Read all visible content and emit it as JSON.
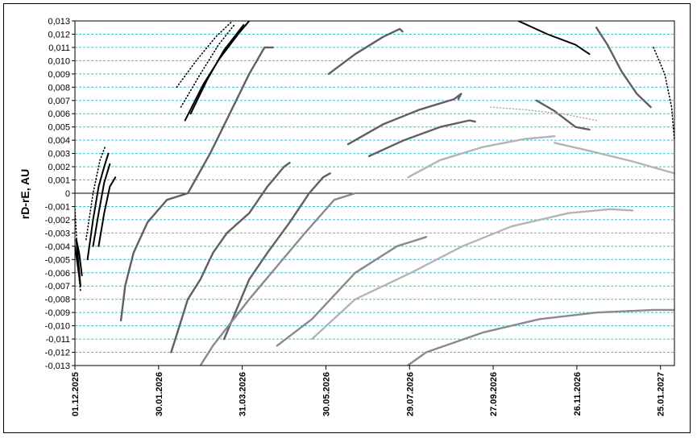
{
  "chart_data": {
    "type": "scatter",
    "ylabel": "rD-rE, AU",
    "xlabel": "",
    "ylim": [
      -0.013,
      0.013
    ],
    "ytick_step": 0.001,
    "xlim": [
      "2025-12-01",
      "2027-02-04"
    ],
    "x_ticks": [
      "01.12.2025",
      "30.01.2026",
      "31.03.2026",
      "30.05.2026",
      "29.07.2026",
      "27.09.2026",
      "26.11.2026",
      "25.01.2027"
    ],
    "grid": {
      "horizontal": true,
      "style": "dashed",
      "color": "#33c3d3"
    },
    "zero_line": true,
    "colors": {
      "black": "#000000",
      "dark": "#606060",
      "mid": "#8a8a8a",
      "light": "#b4b4b4",
      "grid": "#33c3d3"
    },
    "series": [
      {
        "color": "black",
        "style": "solid",
        "points": [
          [
            "2025-12-01",
            -0.004
          ],
          [
            "2025-12-03",
            -0.0055
          ],
          [
            "2025-12-05",
            -0.007
          ],
          [
            "2025-12-02",
            -0.0035
          ],
          [
            "2025-12-04",
            -0.0045
          ],
          [
            "2025-12-06",
            -0.0062
          ]
        ]
      },
      {
        "color": "black",
        "style": "dots",
        "points": [
          [
            "2025-12-01",
            -0.0012
          ],
          [
            "2025-12-02",
            -0.003
          ],
          [
            "2025-12-03",
            -0.0048
          ],
          [
            "2025-12-04",
            -0.0064
          ],
          [
            "2025-12-05",
            -0.0074
          ]
        ]
      },
      {
        "color": "black",
        "style": "solid",
        "points": [
          [
            "2025-12-10",
            -0.005
          ],
          [
            "2025-12-14",
            -0.002
          ],
          [
            "2025-12-18",
            0.0005
          ],
          [
            "2025-12-22",
            0.002
          ],
          [
            "2025-12-25",
            0.003
          ]
        ]
      },
      {
        "color": "black",
        "style": "solid",
        "points": [
          [
            "2025-12-14",
            -0.004
          ],
          [
            "2025-12-18",
            -0.0015
          ],
          [
            "2025-12-22",
            0.0008
          ],
          [
            "2025-12-26",
            0.0022
          ]
        ]
      },
      {
        "color": "black",
        "style": "solid",
        "points": [
          [
            "2025-12-18",
            -0.004
          ],
          [
            "2025-12-22",
            -0.0015
          ],
          [
            "2025-12-26",
            0.0005
          ],
          [
            "2025-12-30",
            0.0012
          ]
        ]
      },
      {
        "color": "black",
        "style": "dots",
        "points": [
          [
            "2025-12-09",
            -0.0035
          ],
          [
            "2025-12-14",
            0.0
          ],
          [
            "2025-12-19",
            0.0025
          ],
          [
            "2025-12-23",
            0.0036
          ]
        ]
      },
      {
        "color": "black",
        "style": "solid",
        "points": [
          [
            "2026-02-18",
            0.0055
          ],
          [
            "2026-03-03",
            0.0082
          ],
          [
            "2026-03-15",
            0.0102
          ],
          [
            "2026-03-28",
            0.012
          ],
          [
            "2026-04-05",
            0.013
          ]
        ]
      },
      {
        "color": "black",
        "style": "solid",
        "points": [
          [
            "2026-02-22",
            0.006
          ],
          [
            "2026-03-06",
            0.0086
          ],
          [
            "2026-03-18",
            0.0108
          ],
          [
            "2026-04-01",
            0.0127
          ]
        ]
      },
      {
        "color": "black",
        "style": "dots",
        "points": [
          [
            "2026-02-12",
            0.008
          ],
          [
            "2026-02-26",
            0.01
          ],
          [
            "2026-03-12",
            0.0118
          ],
          [
            "2026-03-24",
            0.013
          ]
        ]
      },
      {
        "color": "black",
        "style": "dots",
        "points": [
          [
            "2026-02-15",
            0.0065
          ],
          [
            "2026-03-01",
            0.009
          ],
          [
            "2026-03-14",
            0.0112
          ],
          [
            "2026-03-26",
            0.0128
          ]
        ]
      },
      {
        "color": "dark",
        "style": "solid",
        "points": [
          [
            "2026-01-03",
            -0.0096
          ],
          [
            "2026-01-06",
            -0.007
          ],
          [
            "2026-01-12",
            -0.0045
          ],
          [
            "2026-01-22",
            -0.0022
          ],
          [
            "2026-02-05",
            -0.0005
          ],
          [
            "2026-02-20",
            0.0
          ],
          [
            "2026-03-08",
            0.003
          ],
          [
            "2026-03-22",
            0.006
          ],
          [
            "2026-04-05",
            0.009
          ],
          [
            "2026-04-16",
            0.011
          ],
          [
            "2026-04-22",
            0.011
          ]
        ]
      },
      {
        "color": "dark",
        "style": "solid",
        "points": [
          [
            "2026-02-08",
            -0.012
          ],
          [
            "2026-02-14",
            -0.01
          ],
          [
            "2026-02-20",
            -0.008
          ],
          [
            "2026-03-01",
            -0.0065
          ],
          [
            "2026-03-10",
            -0.0045
          ],
          [
            "2026-03-20",
            -0.003
          ],
          [
            "2026-04-05",
            -0.0015
          ],
          [
            "2026-04-18",
            0.0005
          ],
          [
            "2026-04-30",
            0.002
          ],
          [
            "2026-05-04",
            0.0023
          ]
        ]
      },
      {
        "color": "dark",
        "style": "solid",
        "points": [
          [
            "2026-03-18",
            -0.011
          ],
          [
            "2026-03-26",
            -0.009
          ],
          [
            "2026-04-05",
            -0.0065
          ],
          [
            "2026-04-18",
            -0.0045
          ],
          [
            "2026-05-04",
            -0.0022
          ],
          [
            "2026-05-18",
            0.0
          ],
          [
            "2026-05-28",
            0.0012
          ],
          [
            "2026-06-02",
            0.0015
          ]
        ]
      },
      {
        "color": "dark",
        "style": "solid",
        "points": [
          [
            "2026-06-01",
            0.009
          ],
          [
            "2026-06-20",
            0.0105
          ],
          [
            "2026-07-10",
            0.0118
          ],
          [
            "2026-07-22",
            0.0124
          ],
          [
            "2026-07-24",
            0.0122
          ]
        ]
      },
      {
        "color": "dark",
        "style": "solid",
        "points": [
          [
            "2026-06-15",
            0.0037
          ],
          [
            "2026-07-10",
            0.0052
          ],
          [
            "2026-08-05",
            0.0063
          ],
          [
            "2026-08-30",
            0.0071
          ],
          [
            "2026-09-04",
            0.0075
          ],
          [
            "2026-09-02",
            0.0071
          ]
        ]
      },
      {
        "color": "dark",
        "style": "solid",
        "points": [
          [
            "2026-06-30",
            0.0028
          ],
          [
            "2026-07-25",
            0.004
          ],
          [
            "2026-08-20",
            0.005
          ],
          [
            "2026-09-10",
            0.0055
          ],
          [
            "2026-09-14",
            0.0054
          ]
        ]
      },
      {
        "color": "dark",
        "style": "solid",
        "points": [
          [
            "2026-10-28",
            0.007
          ],
          [
            "2026-11-10",
            0.0062
          ],
          [
            "2026-11-25",
            0.005
          ],
          [
            "2026-12-05",
            0.0048
          ]
        ]
      },
      {
        "color": "dark",
        "style": "solid",
        "points": [
          [
            "2026-12-10",
            0.0125
          ],
          [
            "2026-12-18",
            0.0112
          ],
          [
            "2026-12-28",
            0.0092
          ],
          [
            "2027-01-08",
            0.0075
          ],
          [
            "2027-01-18",
            0.0065
          ]
        ]
      },
      {
        "color": "black",
        "style": "solid",
        "points": [
          [
            "2026-10-15",
            0.013
          ],
          [
            "2026-11-05",
            0.012
          ],
          [
            "2026-11-25",
            0.0112
          ],
          [
            "2026-12-05",
            0.0105
          ]
        ]
      },
      {
        "color": "black",
        "style": "dots",
        "points": [
          [
            "2027-01-20",
            0.011
          ],
          [
            "2027-01-28",
            0.009
          ],
          [
            "2027-02-02",
            0.0065
          ],
          [
            "2027-02-04",
            0.004
          ]
        ]
      },
      {
        "color": "mid",
        "style": "solid",
        "points": [
          [
            "2026-02-20",
            -0.0145
          ],
          [
            "2026-03-10",
            -0.0115
          ],
          [
            "2026-04-05",
            -0.008
          ],
          [
            "2026-04-25",
            -0.0055
          ],
          [
            "2026-05-15",
            -0.003
          ],
          [
            "2026-06-05",
            -0.0005
          ],
          [
            "2026-06-20",
            0.0
          ]
        ]
      },
      {
        "color": "mid",
        "style": "solid",
        "points": [
          [
            "2026-04-25",
            -0.0115
          ],
          [
            "2026-05-20",
            -0.0095
          ],
          [
            "2026-06-20",
            -0.006
          ],
          [
            "2026-07-20",
            -0.004
          ],
          [
            "2026-08-10",
            -0.0033
          ]
        ]
      },
      {
        "color": "mid",
        "style": "solid",
        "points": [
          [
            "2026-07-01",
            -0.015
          ],
          [
            "2026-08-10",
            -0.012
          ],
          [
            "2026-09-20",
            -0.0105
          ],
          [
            "2026-10-30",
            -0.0095
          ],
          [
            "2026-12-10",
            -0.009
          ],
          [
            "2027-01-20",
            -0.0088
          ],
          [
            "2027-02-04",
            -0.0088
          ]
        ]
      },
      {
        "color": "light",
        "style": "solid",
        "points": [
          [
            "2026-05-20",
            -0.011
          ],
          [
            "2026-06-20",
            -0.008
          ],
          [
            "2026-07-30",
            -0.006
          ],
          [
            "2026-09-05",
            -0.004
          ],
          [
            "2026-10-10",
            -0.0025
          ],
          [
            "2026-11-20",
            -0.0015
          ],
          [
            "2026-12-20",
            -0.0012
          ],
          [
            "2027-01-05",
            -0.0013
          ]
        ]
      },
      {
        "color": "light",
        "style": "solid",
        "points": [
          [
            "2026-07-28",
            0.0012
          ],
          [
            "2026-08-20",
            0.0025
          ],
          [
            "2026-09-20",
            0.0035
          ],
          [
            "2026-10-20",
            0.0041
          ],
          [
            "2026-11-10",
            0.0043
          ]
        ]
      },
      {
        "color": "light",
        "style": "solid",
        "points": [
          [
            "2026-11-10",
            0.0038
          ],
          [
            "2026-12-05",
            0.0032
          ],
          [
            "2027-01-05",
            0.0024
          ],
          [
            "2027-01-25",
            0.0018
          ],
          [
            "2027-02-04",
            0.0015
          ]
        ]
      },
      {
        "color": "light",
        "style": "dots",
        "points": [
          [
            "2026-09-25",
            0.0065
          ],
          [
            "2026-10-20",
            0.0063
          ],
          [
            "2026-11-15",
            0.006
          ],
          [
            "2026-12-10",
            0.0055
          ]
        ]
      }
    ]
  }
}
